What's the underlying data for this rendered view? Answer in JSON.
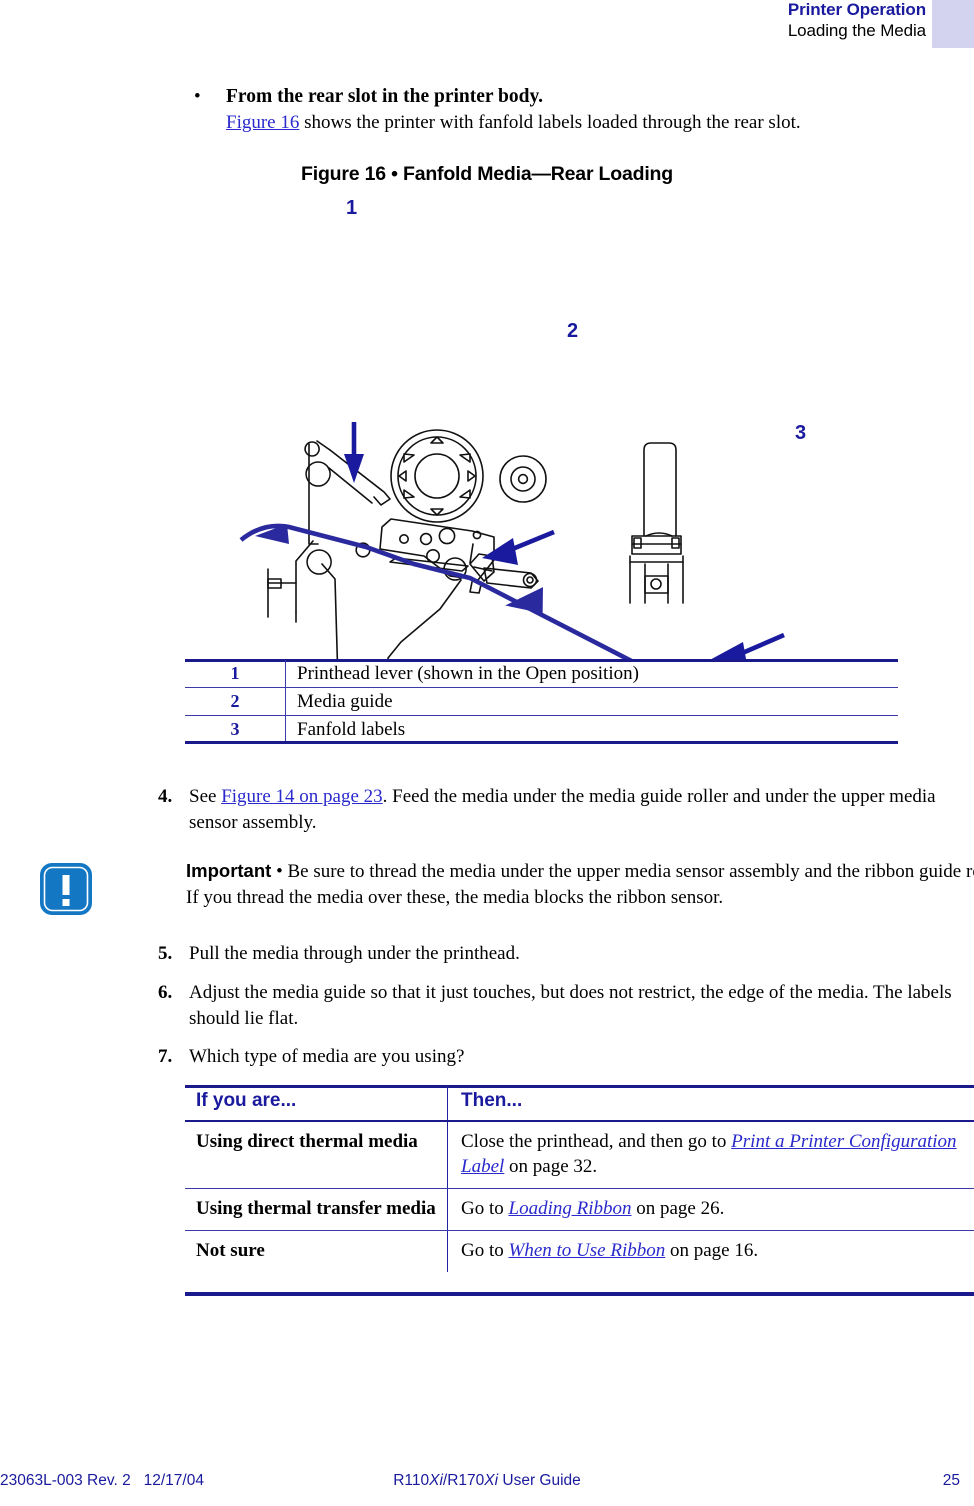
{
  "header": {
    "title": "Printer Operation",
    "subtitle": "Loading the Media",
    "title_color": "#1a1a9e",
    "swatch_color": "#d3d3f0"
  },
  "bullet": {
    "marker": "•",
    "heading": "From the rear slot in the printer body.",
    "xref": "Figure 16",
    "body_after_xref": " shows the printer with fanfold labels loaded through the rear slot."
  },
  "figure": {
    "caption": "Figure 16 • Fanfold Media—Rear Loading",
    "callouts": [
      "1",
      "2",
      "3"
    ],
    "callout_color": "#1a1a9e",
    "media_path_color": "#2a2a9e",
    "line_color": "#000000"
  },
  "legend": {
    "rows": [
      {
        "num": "1",
        "text": "Printhead lever (shown in the Open position)"
      },
      {
        "num": "2",
        "text": "Media guide"
      },
      {
        "num": "3",
        "text": "Fanfold labels"
      }
    ],
    "rule_color": "#1a1a8c"
  },
  "steps": [
    {
      "num": "4.",
      "pre": "See ",
      "xref": "Figure 14 on page 23",
      "post": ". Feed the media under the media guide roller and under the upper media sensor assembly."
    },
    {
      "num": "5.",
      "pre": "Pull the media through under the printhead.",
      "xref": "",
      "post": ""
    },
    {
      "num": "6.",
      "pre": "Adjust the media guide so that it just touches, but does not restrict, the edge of the media. The labels should lie flat.",
      "xref": "",
      "post": ""
    },
    {
      "num": "7.",
      "pre": "Which type of media are you using?",
      "xref": "",
      "post": ""
    }
  ],
  "important": {
    "icon_glyph": "!",
    "icon_color": "#1477c4",
    "label": "Important",
    "separator": " • ",
    "text": "Be sure to thread the media under the upper media sensor assembly and the ribbon guide roller. If you thread the media over these, the media blocks the ribbon sensor."
  },
  "decision_table": {
    "headers": [
      "If you are...",
      "Then..."
    ],
    "header_color": "#1a1a9e",
    "rows": [
      {
        "condition": "Using direct thermal media",
        "action_pre": "Close the printhead, and then go to ",
        "action_xref": "Print a Printer Configuration Label",
        "action_post": " on page 32."
      },
      {
        "condition": "Using thermal transfer media",
        "action_pre": "Go to ",
        "action_xref": "Loading Ribbon",
        "action_post": " on page 26."
      },
      {
        "condition": "Not sure",
        "action_pre": "Go to ",
        "action_xref": "When to Use Ribbon",
        "action_post": " on page 16."
      }
    ]
  },
  "footer": {
    "doc_id": "23063L-003 Rev. 2",
    "date": "12/17/04",
    "guide_pre": "R110",
    "guide_ital1": "Xi",
    "guide_mid": "/R170",
    "guide_ital2": "Xi",
    "guide_post": " User Guide",
    "page_number": "25",
    "color": "#1a1a9e"
  }
}
